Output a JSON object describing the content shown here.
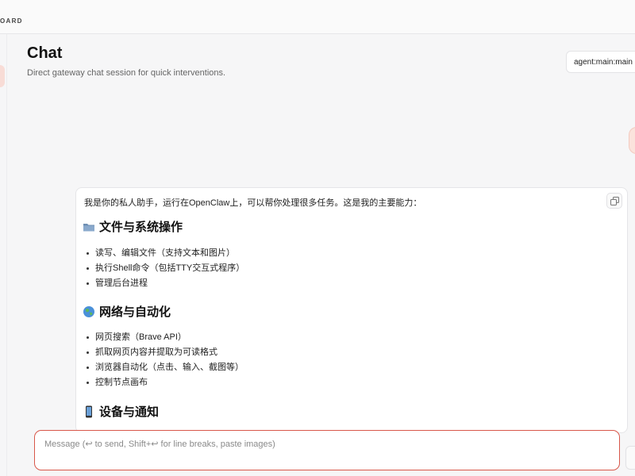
{
  "app": {
    "brand": "OARD"
  },
  "header": {
    "title": "Chat",
    "subtitle": "Direct gateway chat session for quick interventions.",
    "session_value": "agent:main:main"
  },
  "message": {
    "intro": "我是你的私人助手，运行在OpenClaw上，可以帮你处理很多任务。这是我的主要能力：",
    "sections": [
      {
        "icon": "folder-icon",
        "heading": "文件与系统操作",
        "items": [
          "读写、编辑文件（支持文本和图片）",
          "执行Shell命令（包括TTY交互式程序）",
          "管理后台进程"
        ]
      },
      {
        "icon": "globe-icon",
        "heading": "网络与自动化",
        "items": [
          "网页搜索（Brave API）",
          "抓取网页内容并提取为可读格式",
          "浏览器自动化（点击、输入、截图等）",
          "控制节点画布"
        ]
      },
      {
        "icon": "phone-icon",
        "heading": "设备与通知",
        "items": []
      }
    ]
  },
  "composer": {
    "placeholder": "Message (↩ to send, Shift+↩ for line breaks, paste images)"
  },
  "colors": {
    "accent": "#d8574a",
    "accent_soft": "#fbe3dc"
  }
}
